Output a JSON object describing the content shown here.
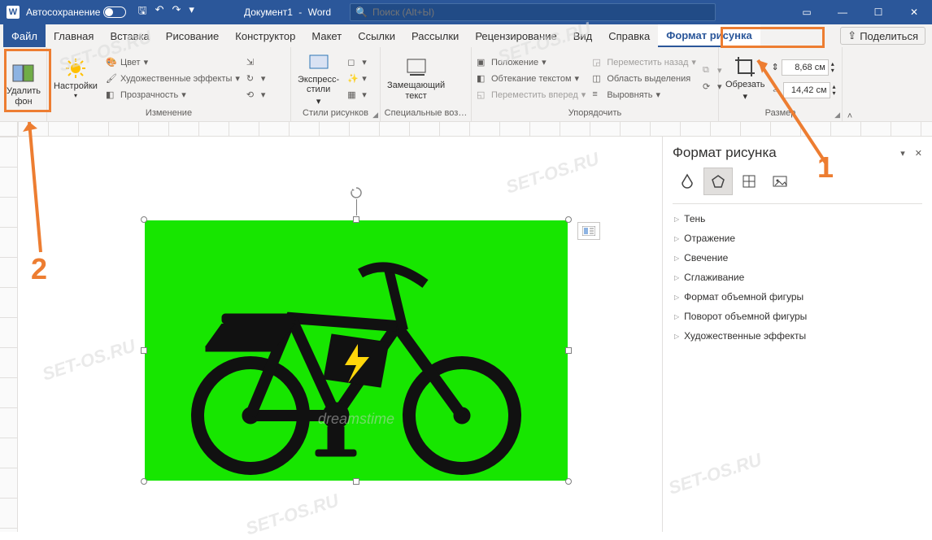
{
  "titlebar": {
    "autosave_label": "Автосохранение",
    "doc_name": "Документ1",
    "app_name": "Word",
    "search_placeholder": "Поиск (Alt+Ы)"
  },
  "tabs": {
    "file": "Файл",
    "home": "Главная",
    "insert": "Вставка",
    "draw": "Рисование",
    "design": "Конструктор",
    "layout": "Макет",
    "references": "Ссылки",
    "mailings": "Рассылки",
    "review": "Рецензирование",
    "view": "Вид",
    "help": "Справка",
    "picture_format": "Формат рисунка",
    "share": "Поделиться"
  },
  "ribbon": {
    "remove_bg": "Удалить\nфон",
    "corrections": "Настройки",
    "color": "Цвет",
    "artistic": "Художественные эффекты",
    "transparency": "Прозрачность",
    "group_adjust": "Изменение",
    "express_styles": "Экспресс-\nстили",
    "group_styles": "Стили рисунков",
    "alt_text": "Замещающий\nтекст",
    "group_access": "Специальные воз…",
    "position": "Положение",
    "wrap": "Обтекание текстом",
    "forward": "Переместить вперед",
    "backward": "Переместить назад",
    "selection_pane": "Область выделения",
    "align": "Выровнять",
    "group_arrange": "Упорядочить",
    "crop": "Обрезать",
    "height": "8,68 см",
    "width": "14,42 см",
    "group_size": "Размер"
  },
  "sidepane": {
    "title": "Формат рисунка",
    "items": [
      "Тень",
      "Отражение",
      "Свечение",
      "Сглаживание",
      "Формат объемной фигуры",
      "Поворот объемной фигуры",
      "Художественные эффекты"
    ]
  },
  "annotations": {
    "one": "1",
    "two": "2"
  },
  "watermark": "SET-OS.RU"
}
